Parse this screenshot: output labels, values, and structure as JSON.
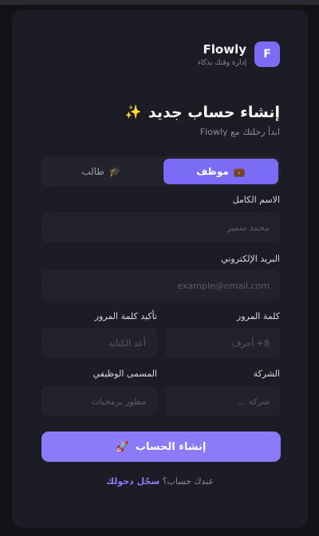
{
  "brand": {
    "logo_letter": "F",
    "name": "Flowly",
    "tagline": "إدارة وقتك بذكاء"
  },
  "header": {
    "title": "إنشاء حساب جديد",
    "sparkle_icon": "✨",
    "subtitle": "ابدأ رحلتك مع Flowly"
  },
  "role_toggle": {
    "options": [
      {
        "label": "موظف",
        "icon": "💼",
        "active": true
      },
      {
        "label": "طالب",
        "icon": "🎓",
        "active": false
      }
    ]
  },
  "form": {
    "full_name": {
      "label": "الاسم الكامل",
      "placeholder": "محمد سمير"
    },
    "email": {
      "label": "البريد الإلكتروني",
      "placeholder": "example@email.com"
    },
    "password": {
      "label": "كلمة المرور",
      "placeholder": "8+ أحرف"
    },
    "confirm_password": {
      "label": "تأكيد كلمة المرور",
      "placeholder": "أعد الكتابة"
    },
    "company": {
      "label": "الشركة",
      "placeholder": "شركة ..."
    },
    "job_title": {
      "label": "المسمى الوظيفي",
      "placeholder": "مطور برمجيات"
    }
  },
  "submit": {
    "label": "إنشاء الحساب",
    "icon": "🚀"
  },
  "footer": {
    "prompt": "عندك حساب؟",
    "link": "سجّل دخولك"
  },
  "colors": {
    "background": "#121217",
    "card": "#1c1c24",
    "accent": "#7b6cf6",
    "input": "#22222b"
  }
}
